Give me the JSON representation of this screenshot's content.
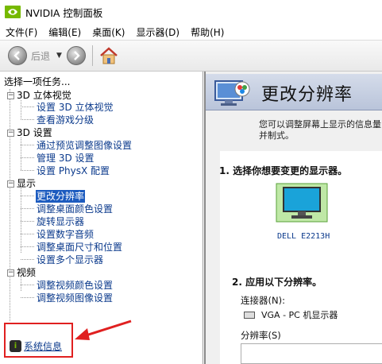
{
  "window": {
    "title": "NVIDIA 控制面板"
  },
  "menu": [
    "文件(F)",
    "编辑(E)",
    "桌面(K)",
    "显示器(D)",
    "帮助(H)"
  ],
  "toolbar": {
    "back_label": "后退"
  },
  "tasks": {
    "header": "选择一项任务...",
    "categories": [
      {
        "label": "3D 立体视觉",
        "items": [
          "设置 3D 立体视觉",
          "查看游戏分级"
        ]
      },
      {
        "label": "3D 设置",
        "items": [
          "通过预览调整图像设置",
          "管理 3D 设置",
          "设置 PhysX 配置"
        ]
      },
      {
        "label": "显示",
        "items": [
          "更改分辨率",
          "调整桌面颜色设置",
          "旋转显示器",
          "设置数字音频",
          "调整桌面尺寸和位置",
          "设置多个显示器"
        ]
      },
      {
        "label": "视频",
        "items": [
          "调整视频颜色设置",
          "调整视频图像设置"
        ]
      }
    ],
    "selected": "更改分辨率"
  },
  "system_info": {
    "label": "系统信息"
  },
  "main": {
    "title": "更改分辨率",
    "description": "您可以调整屏幕上显示的信息量并制式。",
    "step1": "1. 选择你想要变更的显示器。",
    "monitor_name": "DELL E2213H",
    "step2": "2. 应用以下分辨率。",
    "connector_label": "连接器(N):",
    "connector_value": "VGA - PC 机显示器",
    "resolution_label": "分辨率(S)"
  },
  "colors": {
    "nvidia_green": "#76b900",
    "annotation_red": "#e02020",
    "selection_blue": "#1c5bbf",
    "link_blue": "#0b3a8c"
  }
}
